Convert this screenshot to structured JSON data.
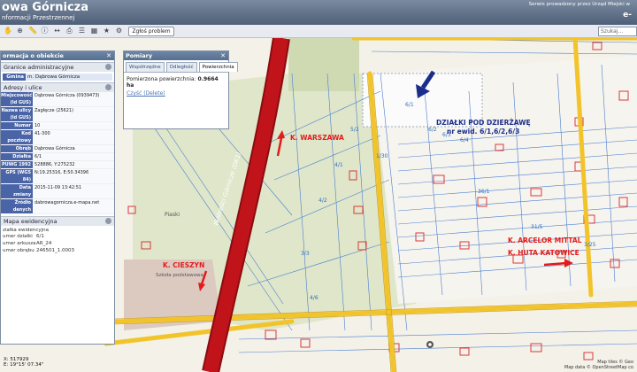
{
  "header": {
    "title": "owa Górnicza",
    "subtitle": "nformacji Przestrzennej",
    "notice": "Serwis prowadzony przez Urząd Miejski w",
    "brand": "e-"
  },
  "toolbar": {
    "report_button": "Zgłoś problem",
    "search_placeholder": "Szukaj..."
  },
  "info_panel": {
    "title": "ormacja o obiekcie",
    "admin_section": "Granice administracyjne",
    "admin_key": "Gmina",
    "admin_value": "m. Dąbrowa Górnicza",
    "address_section": "Adresy i ulice",
    "address_rows": [
      {
        "key": "Miejscowość (Id GUS)",
        "value": "Dąbrowa Górnicza (0939473)"
      },
      {
        "key": "Nazwa ulicy (Id GUS)",
        "value": "Zagłęcze (25621)"
      },
      {
        "key": "Numer",
        "value": "10"
      },
      {
        "key": "Kod pocztowy",
        "value": "41-300"
      },
      {
        "key": "Obręb",
        "value": "Dąbrowa Górnicza"
      },
      {
        "key": "Działka",
        "value": "6/1"
      },
      {
        "key": "PUWG 1992",
        "value": "528886, Y:275232"
      },
      {
        "key": "GPS (WGS 84)",
        "value": "N:19.25316, E:50.34396"
      },
      {
        "key": "Data zmiany",
        "value": "2015-11-09 13:42:51"
      },
      {
        "key": "Źródło danych",
        "value": "dabrowagornicza.e-mapa.net"
      }
    ],
    "map_section": "Mapa ewidencyjna",
    "ew_subhead": "ziałka ewidencyjna",
    "ew_rows": [
      {
        "key": "umer działki",
        "value": "6/1"
      },
      {
        "key": "umer arkusza",
        "value": "AR_24"
      },
      {
        "key": "umer obrębu",
        "value": "246501_1.0003"
      }
    ]
  },
  "measure_panel": {
    "title": "Pomiary",
    "tabs": [
      "Współrzędne",
      "Odległość",
      "Powierzchnia"
    ],
    "result_label": "Pomierzona powierzchnia:",
    "result_value": "0.9664 ha",
    "clear_label": "Czyść (Delete)"
  },
  "map": {
    "parcel_numbers": [
      "6/1",
      "6/2",
      "6/3",
      "6/4",
      "1/30",
      "5/2",
      "4/1",
      "4/2",
      "3/3",
      "4/6",
      "36/1",
      "31/5",
      "3/25"
    ],
    "annotations": {
      "warszawa": "K. WARSZAWA",
      "cieszyn": "K. CIESZYN",
      "dzialki_title": "DZIAŁKI POD DZIERŻAWĘ",
      "dzialki_numbers": "nr ewid. 6/1,6/2,6/3",
      "arcelor": "K. ARCELOR MITTAL",
      "huta": "K. HUTA KATOWICE"
    },
    "road_name": "Wolności Górnicze (DK1)",
    "place_name": "Piaski",
    "school_label": "Szkoła podstawowa"
  },
  "footer": {
    "coord_x": "X: 517929",
    "coord_y": "E: 19°15' 07.34\"",
    "attribution_1": "Map tiles © Geo",
    "attribution_2": "Map data © OpenStreetMap co"
  },
  "colors": {
    "highway": "#c0141a",
    "roads": "#f2c42a",
    "parcel_lines": "#4b7fd1",
    "buildings": "#d93a3a",
    "annotation_red": "#e31b1b",
    "annotation_blue": "#1b2d8c"
  }
}
